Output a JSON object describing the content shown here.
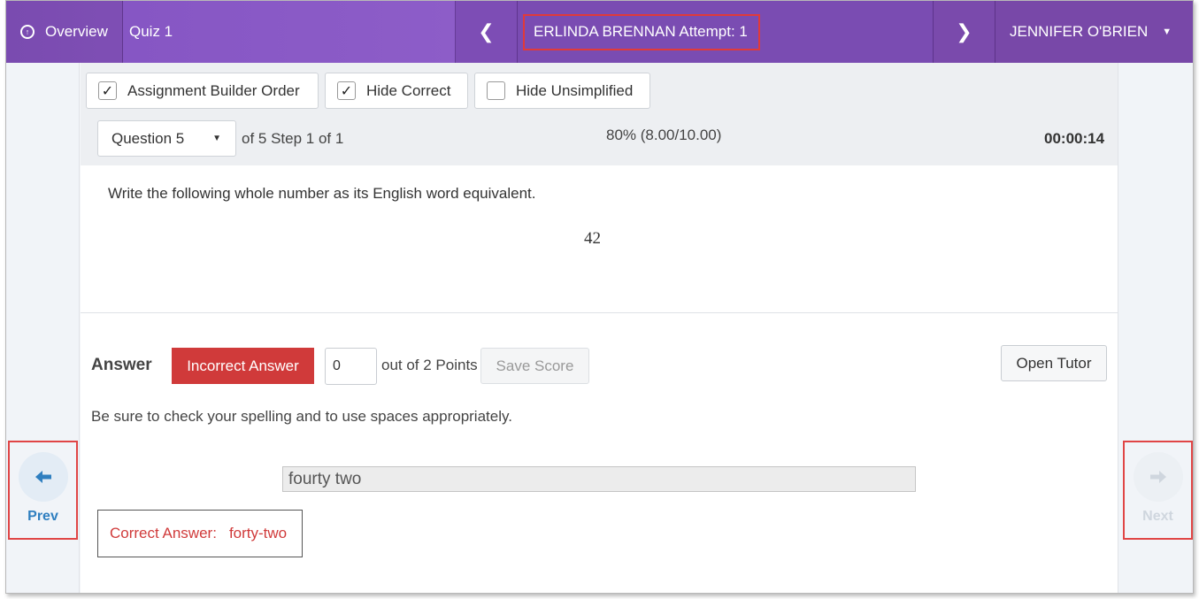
{
  "header": {
    "overview_label": "Overview",
    "quiz_title": "Quiz 1",
    "prev_arrow": "❮",
    "student_attempt": "ERLINDA BRENNAN Attempt: 1",
    "next_arrow": "❯",
    "user_name": "JENNIFER O'BRIEN",
    "user_caret": "▼"
  },
  "toolbar": {
    "checkboxes": [
      {
        "label": "Assignment Builder Order",
        "checked": true,
        "mark": "✓"
      },
      {
        "label": "Hide Correct",
        "checked": true,
        "mark": "✓"
      },
      {
        "label": "Hide Unsimplified",
        "checked": false,
        "mark": ""
      }
    ],
    "question_select": "Question 5",
    "question_caret": "▼",
    "question_position": "of 5 Step 1 of 1",
    "score": "80% (8.00/10.00)",
    "timer": "00:00:14"
  },
  "question": {
    "prompt": "Write the following whole number as its English word equivalent.",
    "value": "42"
  },
  "answer": {
    "label": "Answer",
    "status_button": "Incorrect Answer",
    "points_value": "0",
    "out_of_text": "out of 2 Points",
    "save_score": "Save Score",
    "open_tutor": "Open Tutor",
    "hint": "Be sure to check your spelling and to use spaces appropriately.",
    "student_response": "fourty two",
    "correct_label": "Correct Answer:",
    "correct_value": "forty-two"
  },
  "navigation": {
    "prev_label": "Prev",
    "prev_icon": "arrow-left-icon",
    "prev_glyph": "🠈",
    "next_label": "Next",
    "next_icon": "arrow-right-icon",
    "next_glyph": "🠊",
    "next_enabled": false
  },
  "colors": {
    "header_purple": "#7a4bb0",
    "incorrect_red": "#d03a3a",
    "prev_blue": "#2f7fc0",
    "highlight_border": "#e03a3a"
  }
}
